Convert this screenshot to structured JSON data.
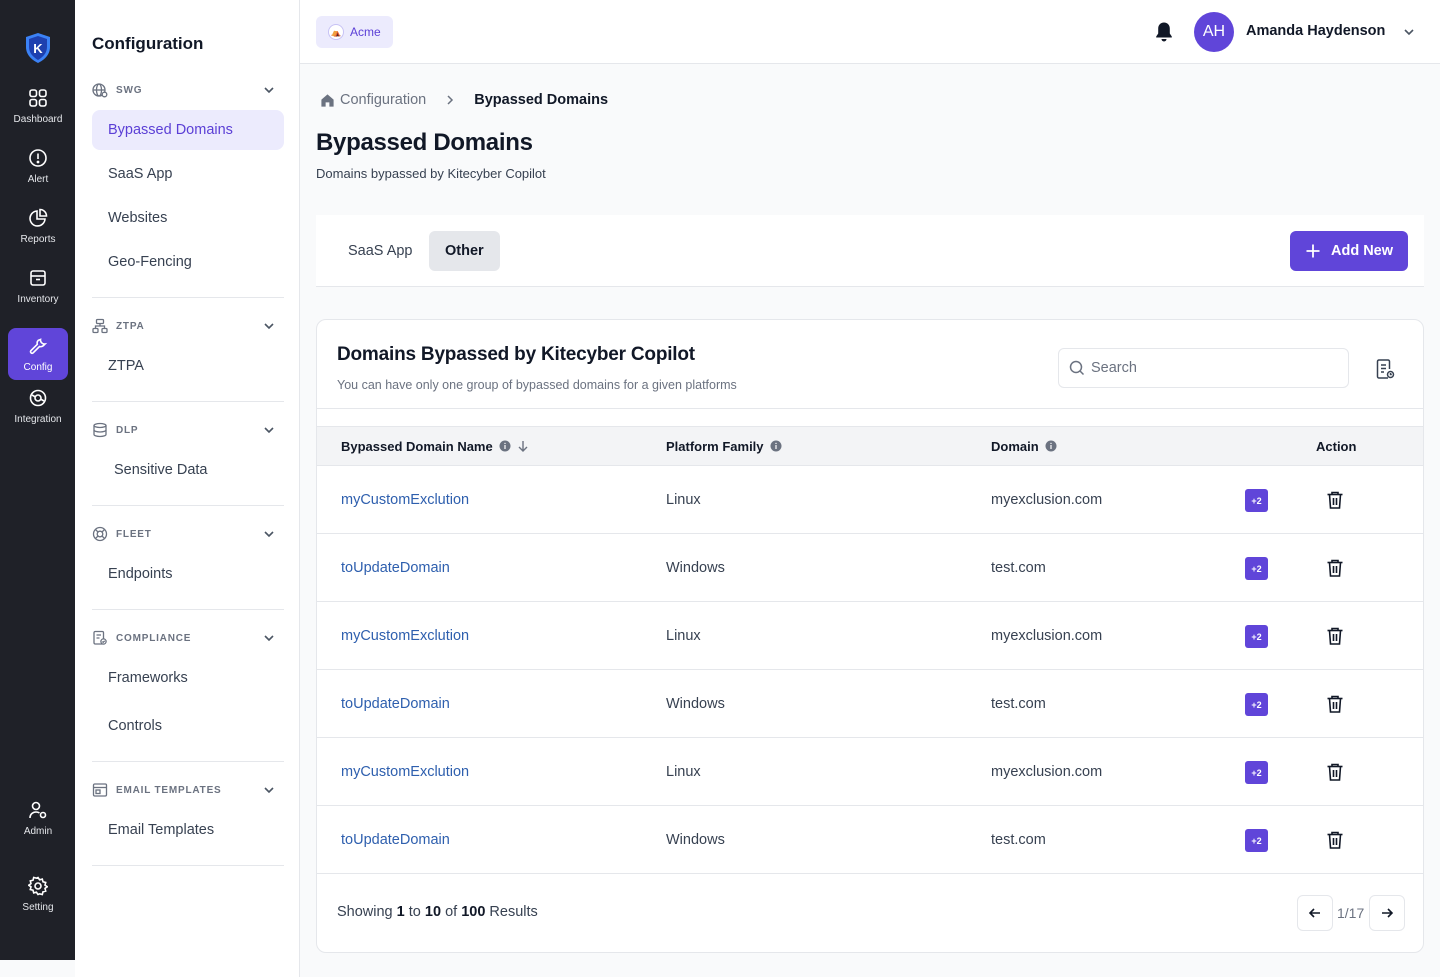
{
  "rail": {
    "items": [
      {
        "label": "Dashboard",
        "icon": "dashboard-icon"
      },
      {
        "label": "Alert",
        "icon": "alert-icon"
      },
      {
        "label": "Reports",
        "icon": "reports-icon"
      },
      {
        "label": "Inventory",
        "icon": "inventory-icon"
      },
      {
        "label": "Config",
        "icon": "config-icon",
        "active": true
      },
      {
        "label": "Integration",
        "icon": "integration-icon"
      },
      {
        "label": "Admin",
        "icon": "admin-icon"
      },
      {
        "label": "Setting",
        "icon": "setting-icon"
      }
    ]
  },
  "config_sidebar": {
    "title": "Configuration",
    "groups": [
      {
        "heading": "SWG",
        "icon": "globe-icon",
        "items": [
          "Bypassed Domains",
          "SaaS App",
          "Websites",
          "Geo-Fencing"
        ]
      },
      {
        "heading": "ZTPA",
        "icon": "network-icon",
        "items": [
          "ZTPA"
        ]
      },
      {
        "heading": "DLP",
        "icon": "database-icon",
        "items": [
          "Sensitive Data"
        ]
      },
      {
        "heading": "FLEET",
        "icon": "lifebuoy-icon",
        "items": [
          "Endpoints"
        ]
      },
      {
        "heading": "COMPLIANCE",
        "icon": "compliance-icon",
        "items": [
          "Frameworks",
          "Controls"
        ]
      },
      {
        "heading": "EMAIL TEMPLATES",
        "icon": "template-icon",
        "items": [
          "Email Templates"
        ]
      }
    ],
    "active_item": "Bypassed Domains"
  },
  "header": {
    "org": "Acme",
    "user_initials": "AH",
    "user_name": "Amanda Haydenson"
  },
  "breadcrumb": {
    "parent": "Configuration",
    "current": "Bypassed Domains"
  },
  "page": {
    "title": "Bypassed Domains",
    "subtitle": "Domains bypassed by Kitecyber Copilot"
  },
  "tabs": {
    "items": [
      "SaaS App",
      "Other"
    ],
    "active": "Other",
    "add_label": "Add New"
  },
  "card": {
    "title": "Domains Bypassed by Kitecyber Copilot",
    "subtitle": "You can have only one group of bypassed domains for a given platforms",
    "search_placeholder": "Search"
  },
  "table": {
    "columns": {
      "name": "Bypassed Domain Name",
      "platform": "Platform Family",
      "domain": "Domain",
      "action": "Action"
    },
    "rows": [
      {
        "name": "myCustomExclution",
        "platform": "Linux",
        "domain": "myexclusion.com",
        "more": "+2"
      },
      {
        "name": "toUpdateDomain",
        "platform": "Windows",
        "domain": "test.com",
        "more": "+2"
      },
      {
        "name": "myCustomExclution",
        "platform": "Linux",
        "domain": "myexclusion.com",
        "more": "+2"
      },
      {
        "name": "toUpdateDomain",
        "platform": "Windows",
        "domain": "test.com",
        "more": "+2"
      },
      {
        "name": "myCustomExclution",
        "platform": "Linux",
        "domain": "myexclusion.com",
        "more": "+2"
      },
      {
        "name": "toUpdateDomain",
        "platform": "Windows",
        "domain": "test.com",
        "more": "+2"
      }
    ]
  },
  "footer": {
    "showing": "Showing",
    "from": "1",
    "to_word": "to",
    "to": "10",
    "of_word": "of",
    "total": "100",
    "results": "Results",
    "page_info": "1/17"
  },
  "colors": {
    "accent": "#6045d9",
    "rail_bg": "#1f2128",
    "link": "#2e5fae"
  }
}
